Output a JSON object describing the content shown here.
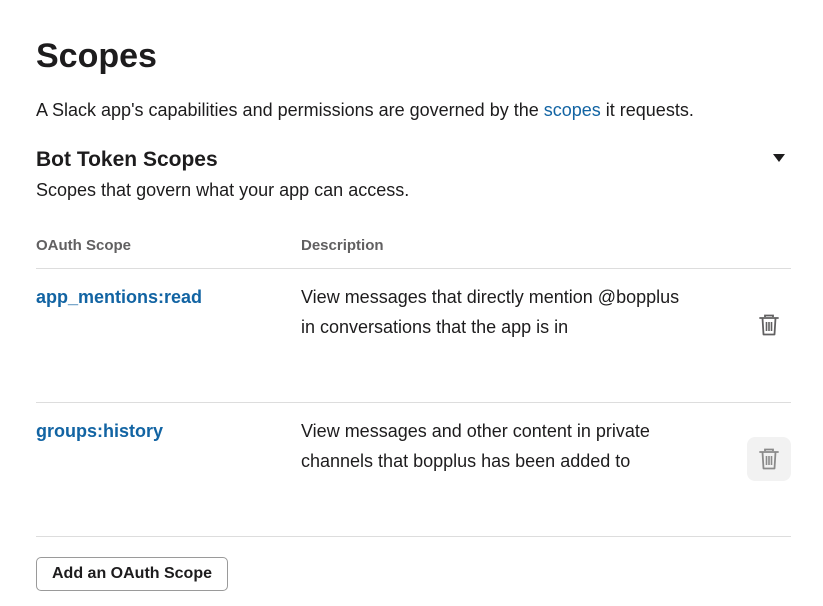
{
  "header": {
    "title": "Scopes",
    "intro_before": "A Slack app's capabilities and permissions are governed by the ",
    "intro_link": "scopes",
    "intro_after": " it requests."
  },
  "bot_token_section": {
    "title": "Bot Token Scopes",
    "subtitle": "Scopes that govern what your app can access.",
    "toggle_icon": "caret-down-icon",
    "columns": {
      "scope": "OAuth Scope",
      "description": "Description"
    },
    "rows": [
      {
        "scope": "app_mentions:read",
        "description": "View messages that directly mention @bopplus in conversations that the app is in",
        "remove_icon": "trash-icon",
        "hovered": false
      },
      {
        "scope": "groups:history",
        "description": "View messages and other content in private channels that bopplus has been added to",
        "remove_icon": "trash-icon",
        "hovered": true
      }
    ],
    "add_button_label": "Add an OAuth Scope"
  },
  "colors": {
    "link": "#1264a3",
    "text": "#1d1c1d",
    "muted": "#616061",
    "divider": "#dddddd",
    "icon": "#616061",
    "hover_bg": "#f2f2f2"
  }
}
